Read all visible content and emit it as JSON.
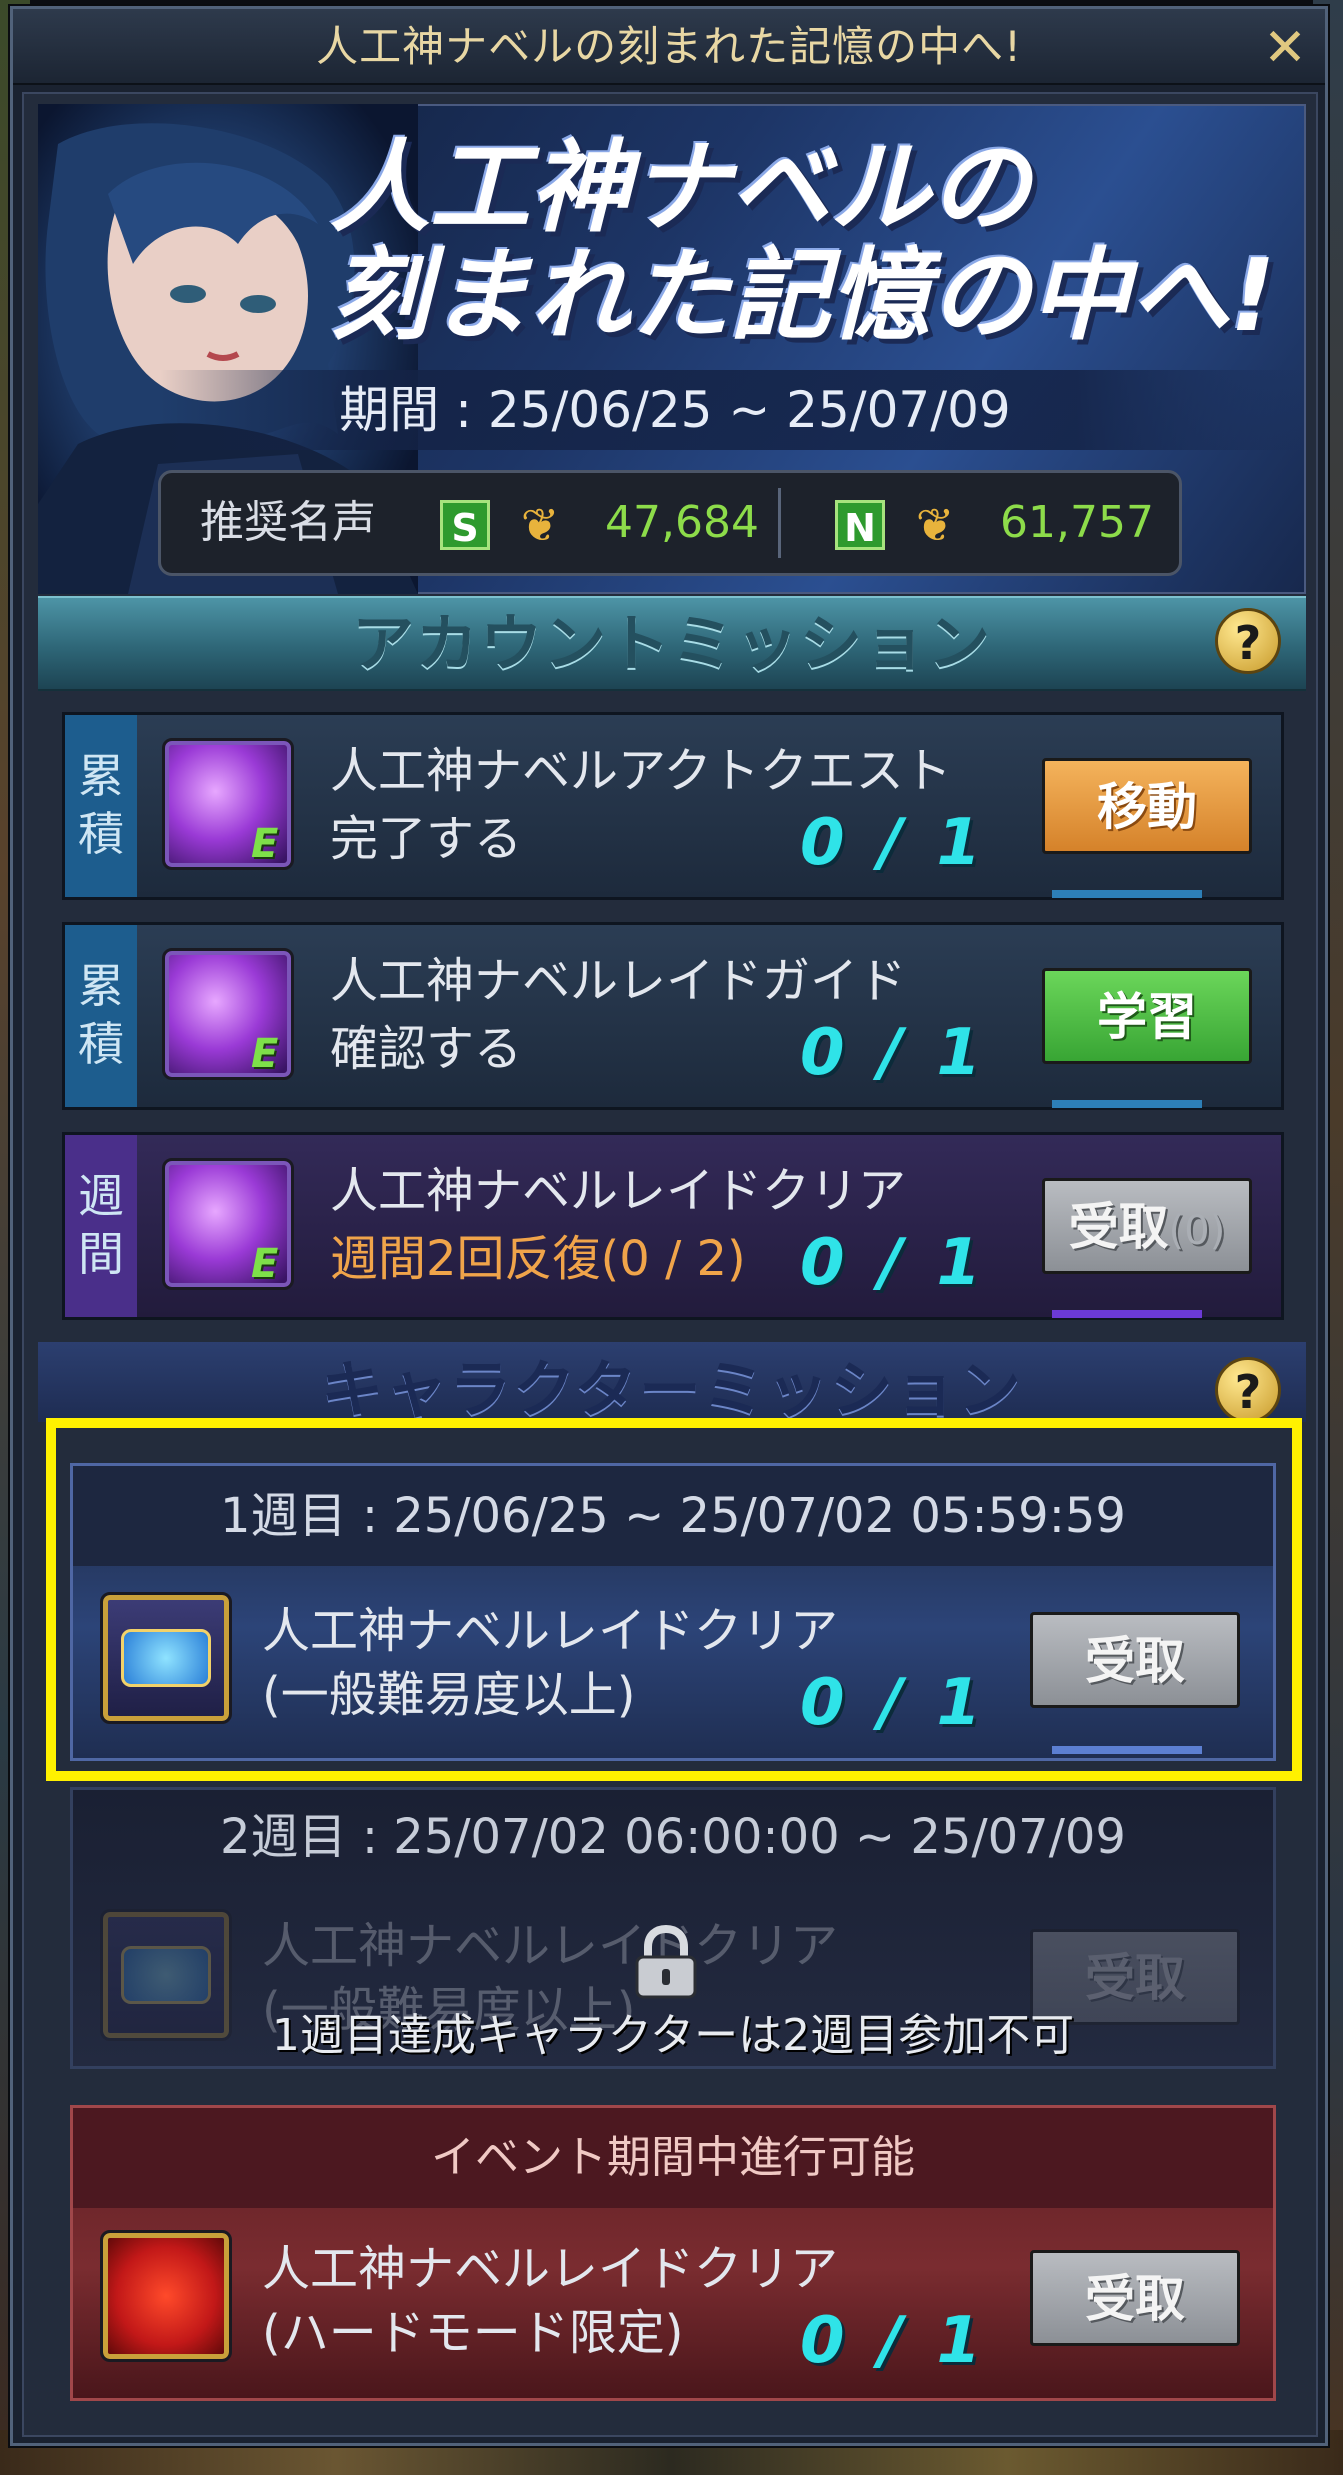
{
  "window": {
    "title": "人工神ナベルの刻まれた記憶の中へ!",
    "close_icon": "✕"
  },
  "banner": {
    "title_line1": "人工神ナベルの",
    "title_line2": "刻まれた記憶の中へ!",
    "period": "期間 : 25/06/25 ~ 25/07/09",
    "fame": {
      "label": "推奨名声",
      "s_grade": "S",
      "s_value": "47,684",
      "n_grade": "N",
      "n_value": "61,757",
      "icon": "fame-laurel-icon"
    }
  },
  "account_section": {
    "title": "アカウントミッション",
    "help": "?",
    "missions": [
      {
        "tag": "累\n積",
        "name": "人工神ナベルアクトクエスト",
        "sub": "完了する",
        "progress": "0 / 1",
        "button": "移動",
        "button_color": "#d5822a",
        "icon_letter": "E"
      },
      {
        "tag": "累\n積",
        "name": "人工神ナベルレイドガイド",
        "sub": "確認する",
        "progress": "0 / 1",
        "button": "学習",
        "button_color": "#38a534",
        "icon_letter": "E"
      },
      {
        "tag": "週\n間",
        "name": "人工神ナベルレイドクリア",
        "sub": "週間2回反復(0 / 2)",
        "progress": "0 / 1",
        "button": "受取",
        "button_count": "(0)",
        "button_color": "#8c9096",
        "icon_letter": "E"
      }
    ]
  },
  "character_section": {
    "title": "キャラクターミッション",
    "help": "?",
    "week1": {
      "period": "1週目 : 25/06/25 ~ 25/07/02 05:59:59",
      "name": "人工神ナベルレイドクリア",
      "sub": "(一般難易度以上)",
      "progress": "0 / 1",
      "button": "受取"
    },
    "week2": {
      "period": "2週目 : 25/07/02 06:00:00 ~ 25/07/09",
      "name": "人工神ナベルレイドクリア",
      "sub": "(一般難易度以上)",
      "button": "受取",
      "locked_notice": "1週目達成キャラクターは2週目参加不可"
    },
    "event": {
      "header": "イベント期間中進行可能",
      "name": "人工神ナベルレイドクリア",
      "sub": "(ハードモード限定)",
      "progress": "0 / 1",
      "button": "受取"
    }
  },
  "colors": {
    "highlight": "#fff100",
    "progress": "#2fe3e8",
    "fame_value": "#8ddc4a"
  }
}
